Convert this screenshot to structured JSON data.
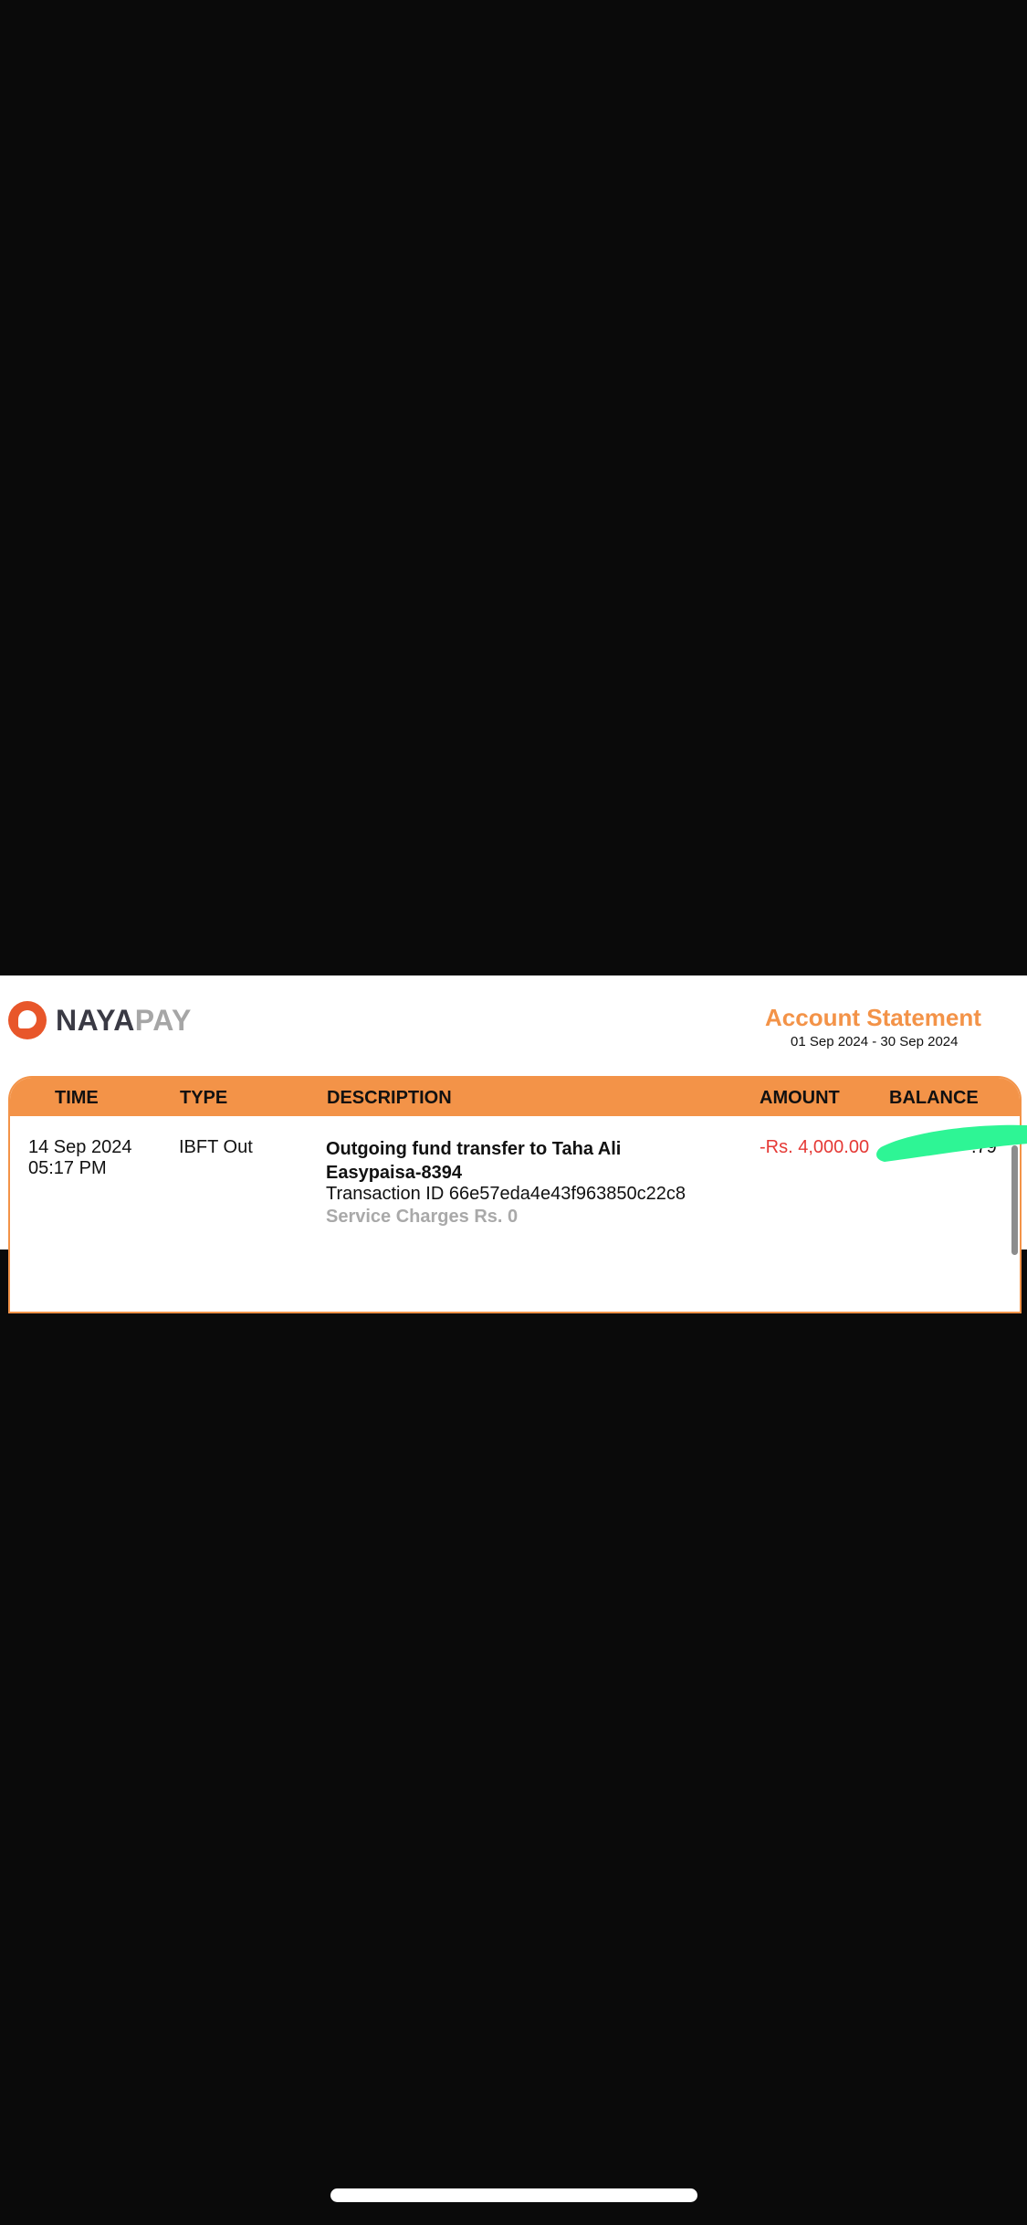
{
  "brand": {
    "name_part1": "NAYA",
    "name_part2": "PAY",
    "colors": {
      "orange": "#f39348",
      "logo_red": "#e8562a",
      "dark": "#3a3a44"
    }
  },
  "statement": {
    "title": "Account Statement",
    "period": "01 Sep 2024 - 30 Sep 2024"
  },
  "table": {
    "headers": {
      "time": "TIME",
      "type": "TYPE",
      "description": "DESCRIPTION",
      "amount": "AMOUNT",
      "balance": "BALANCE"
    },
    "rows": [
      {
        "date": "14 Sep 2024",
        "time": "05:17 PM",
        "type": "IBFT Out",
        "description_line1": "Outgoing fund transfer to Taha Ali",
        "description_line2": "Easypaisa-8394",
        "transaction_id": "Transaction ID 66e57eda4e43f963850c22c8",
        "service_charges": "Service Charges Rs. 0",
        "amount": "-Rs. 4,000.00",
        "amount_color": "#e53935",
        "balance_visible_fragment": ".79",
        "balance_redacted": true
      }
    ]
  },
  "redaction_color": "#2ef595"
}
